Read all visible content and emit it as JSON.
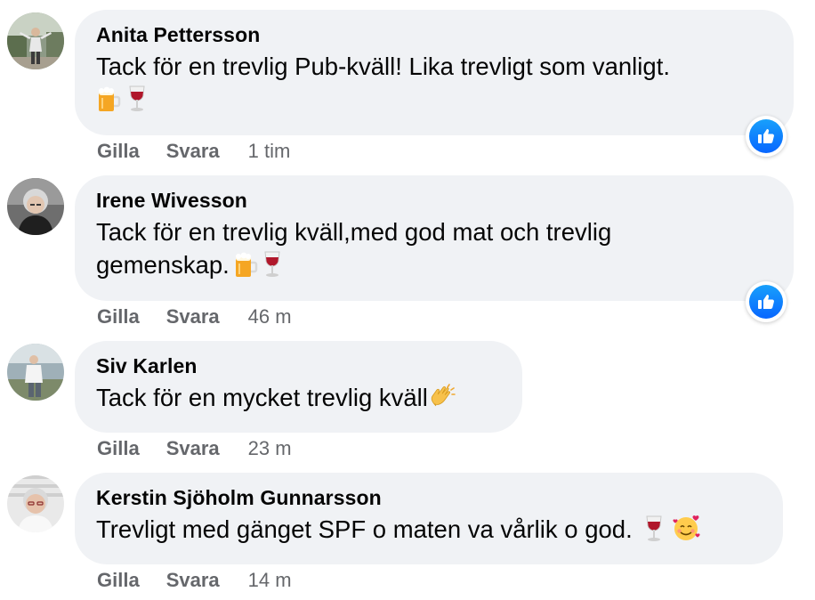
{
  "colors": {
    "bubble_bg": "#f0f2f5",
    "meta_text": "#65676b",
    "like_blue": "#0866ff"
  },
  "comments": [
    {
      "author": "Anita Pettersson",
      "text": "Tack för en trevlig Pub-kväll! Lika trevligt som vanligt.",
      "emojis": [
        "beer-mug-emoji",
        "wine-glass-emoji"
      ],
      "like_label": "Gilla",
      "reply_label": "Svara",
      "time": "1 tim",
      "reaction": "like-icon"
    },
    {
      "author": "Irene Wivesson",
      "text": "Tack för en trevlig kväll,med god mat och trevlig gemenskap.",
      "emojis": [
        "beer-mug-emoji",
        "wine-glass-emoji"
      ],
      "like_label": "Gilla",
      "reply_label": "Svara",
      "time": "46 m",
      "reaction": "like-icon"
    },
    {
      "author": "Siv Karlen",
      "text": "Tack för en mycket trevlig kväll",
      "emojis": [
        "clapping-hands-emoji"
      ],
      "like_label": "Gilla",
      "reply_label": "Svara",
      "time": "23 m"
    },
    {
      "author": "Kerstin Sjöholm Gunnarsson",
      "text": "Trevligt med gänget SPF o maten va vårlik o god.",
      "emojis": [
        "wine-glass-emoji",
        "smiling-face-with-hearts-emoji"
      ],
      "like_label": "Gilla",
      "reply_label": "Svara",
      "time": "14 m"
    }
  ]
}
